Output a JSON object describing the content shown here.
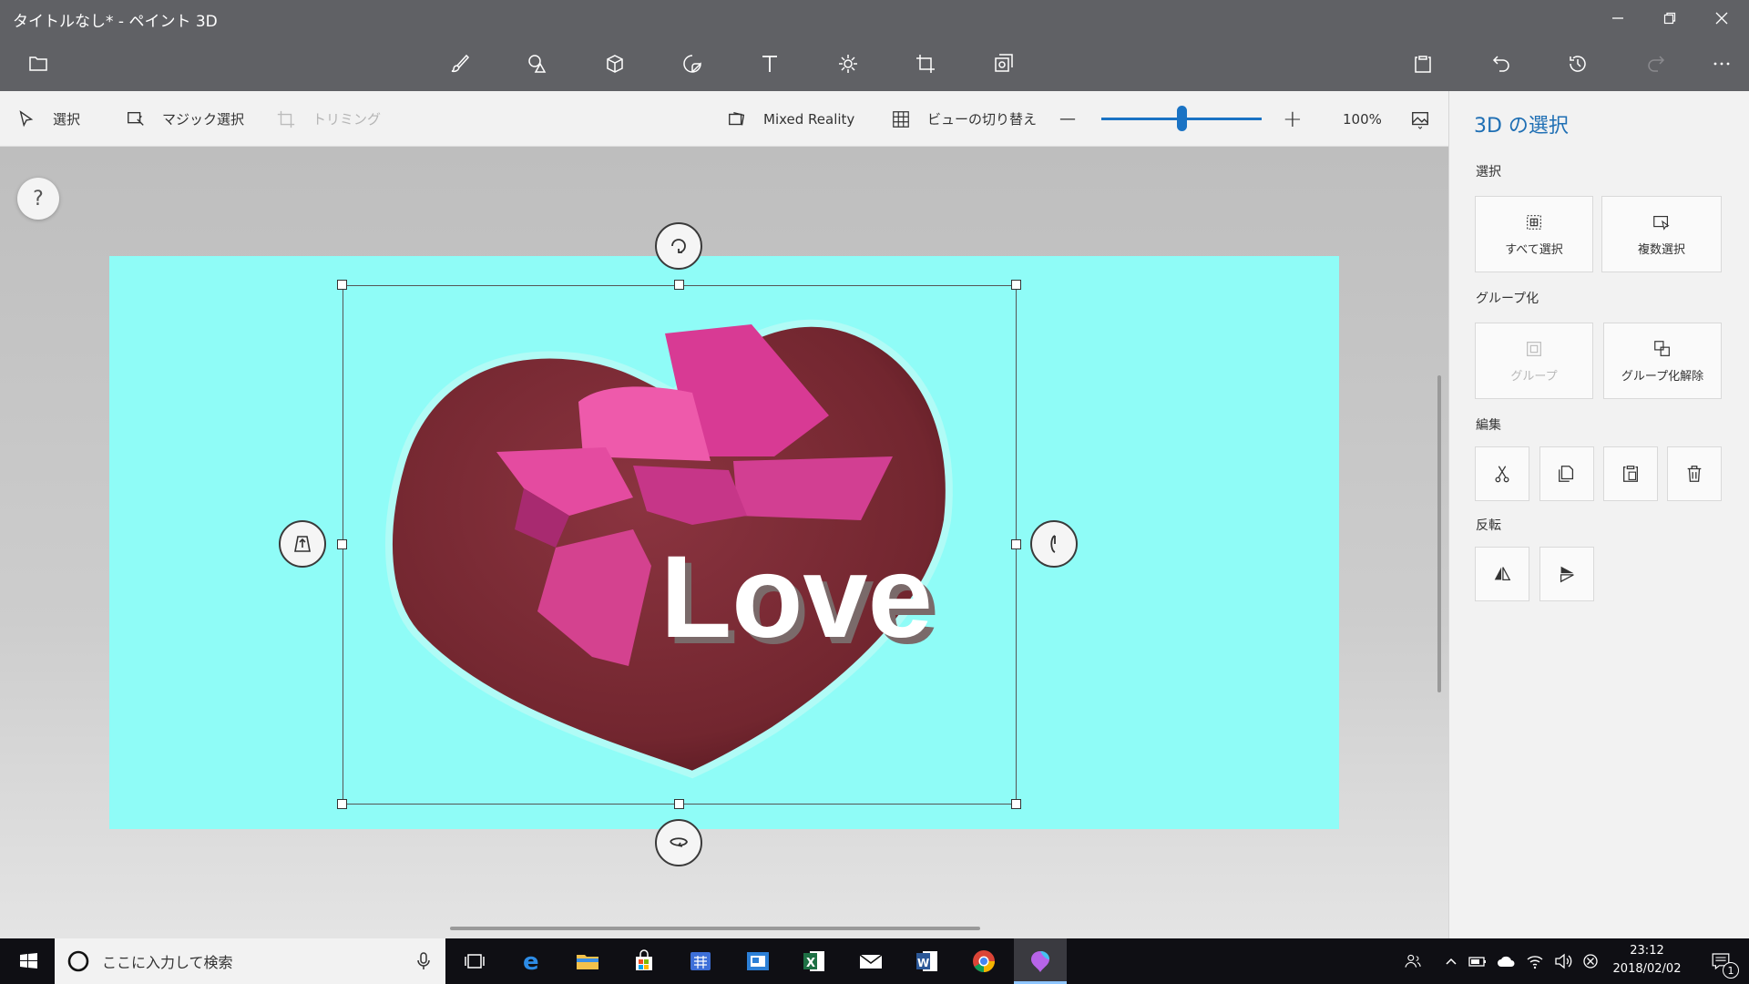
{
  "window": {
    "title": "タイトルなし* - ペイント 3D",
    "controls": [
      "minimize",
      "restore",
      "close"
    ]
  },
  "toolbar": {
    "left_icon": "folder-icon",
    "tools": [
      "brush-icon",
      "shapes-2d-icon",
      "cube-3d-icon",
      "sticker-icon",
      "text-icon",
      "effects-icon",
      "canvas-icon",
      "remix-icon"
    ],
    "right_icons": [
      "paste-icon",
      "undo-icon",
      "history-icon",
      "redo-icon",
      "more-icon"
    ]
  },
  "subbar": {
    "select_label": "選択",
    "magic_select_label": "マジック選択",
    "crop_label": "トリミング",
    "mixed_reality_label": "Mixed Reality",
    "view_switch_label": "ビューの切り替え",
    "zoom_minus": "—",
    "zoom_plus": "+",
    "zoom_level": 0.5,
    "zoom_label": "100%"
  },
  "canvas": {
    "help_label": "?",
    "background_color": "#8ffcf7",
    "object_text": "Love",
    "heart_color": "#7d2b35",
    "ribbon_color": "#e0489e"
  },
  "panel": {
    "title": "3D の選択",
    "select_section": "選択",
    "select_all_label": "すべて選択",
    "multi_select_label": "複数選択",
    "group_section": "グループ化",
    "group_label": "グループ",
    "ungroup_label": "グループ化解除",
    "edit_section": "編集",
    "edit_icons": [
      "cut-icon",
      "copy-icon",
      "paste-icon",
      "delete-icon"
    ],
    "flip_section": "反転",
    "flip_icons": [
      "flip-horizontal-icon",
      "flip-vertical-icon"
    ]
  },
  "taskbar": {
    "search_placeholder": "ここに入力して検索",
    "apps": [
      "task-view-icon",
      "edge-icon",
      "file-explorer-icon",
      "store-icon",
      "calendar-icon",
      "news-icon",
      "excel-icon",
      "mail-icon",
      "word-icon",
      "chrome-icon",
      "paint3d-icon"
    ],
    "time": "23:12",
    "date": "2018/02/02",
    "notification_count": "1"
  }
}
